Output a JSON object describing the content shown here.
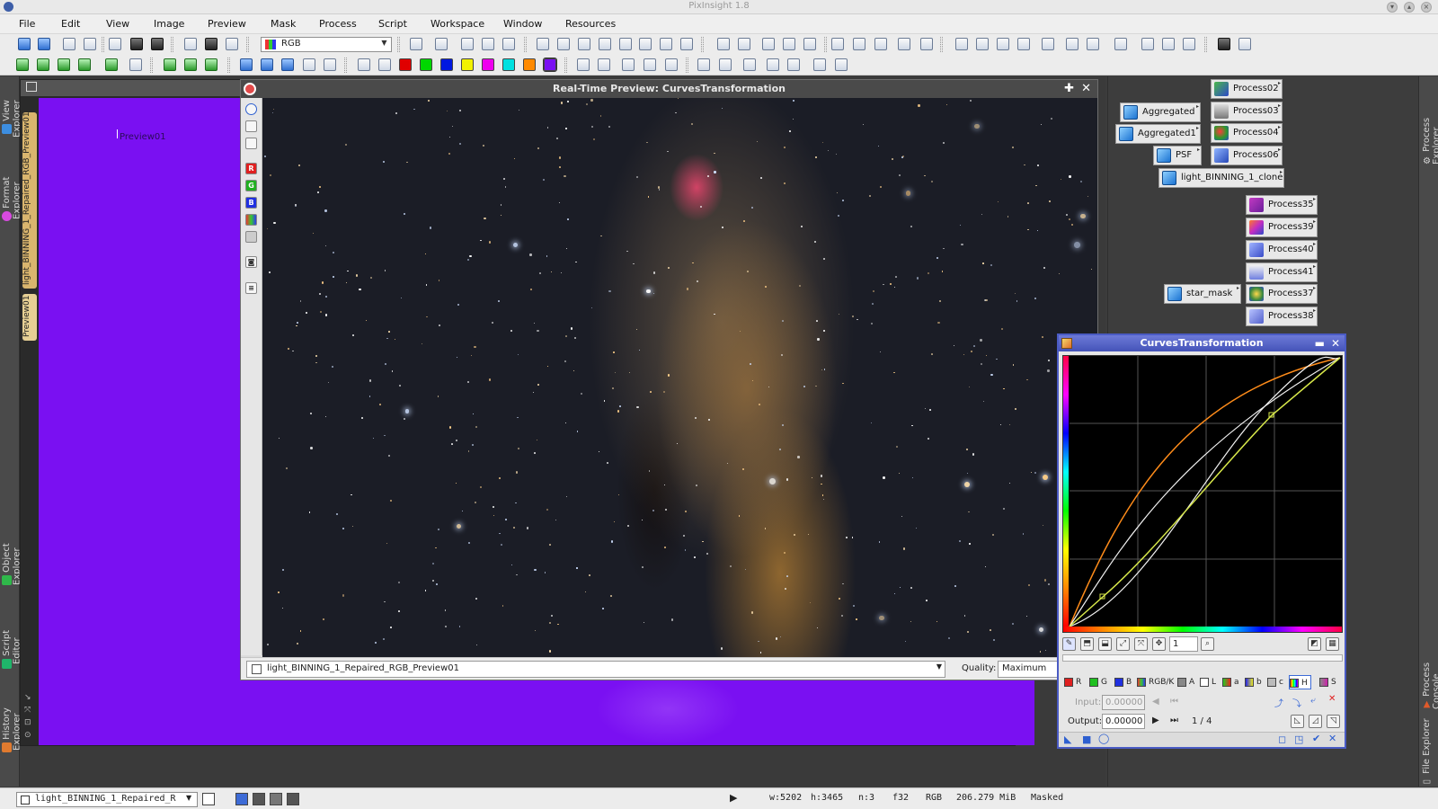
{
  "app": {
    "title": "PixInsight 1.8"
  },
  "menu": [
    "File",
    "Edit",
    "View",
    "Image",
    "Preview",
    "Mask",
    "Process",
    "Script",
    "Workspace",
    "Window",
    "Resources"
  ],
  "toolbar": {
    "color_space_select": "RGB"
  },
  "left_dock": {
    "view_explorer": "View Explorer",
    "format_explorer": "Format Explorer",
    "object_explorer": "Object Explorer",
    "script_editor": "Script Editor",
    "history_explorer": "History Explorer"
  },
  "right_dock": {
    "process_explorer": "Process Explorer",
    "process_console": "Process Console",
    "file_explorer": "File Explorer"
  },
  "image_window": {
    "preview_label": "Preview01",
    "side_tab_main": "light_BINNING_1_Repaired_RGB_Preview01",
    "side_tab_preview": "Preview01"
  },
  "realtime_preview": {
    "title": "Real-Time Preview: CurvesTransformation",
    "view_select": "light_BINNING_1_Repaired_RGB_Preview01",
    "quality_label": "Quality:",
    "quality_value": "Maximum",
    "channel_buttons": [
      "R",
      "G",
      "B"
    ]
  },
  "process_icons": [
    {
      "label": "Process02",
      "kind": "process"
    },
    {
      "label": "Aggregated",
      "kind": "cube"
    },
    {
      "label": "Process03",
      "kind": "process"
    },
    {
      "label": "Aggregated1",
      "kind": "cube"
    },
    {
      "label": "Process04",
      "kind": "process"
    },
    {
      "label": "PSF",
      "kind": "cube"
    },
    {
      "label": "Process06",
      "kind": "process"
    },
    {
      "label": "light_BINNING_1_clone",
      "kind": "cube"
    },
    {
      "label": "Process35",
      "kind": "process"
    },
    {
      "label": "Process39",
      "kind": "process"
    },
    {
      "label": "Process40",
      "kind": "process"
    },
    {
      "label": "Process41",
      "kind": "process"
    },
    {
      "label": "star_mask",
      "kind": "cube"
    },
    {
      "label": "Process37",
      "kind": "process"
    },
    {
      "label": "Process38",
      "kind": "process"
    }
  ],
  "curves": {
    "title": "CurvesTransformation",
    "zoom_value": "1",
    "channels": [
      "R",
      "G",
      "B",
      "RGB/K",
      "A",
      "L",
      "a",
      "b",
      "c",
      "H",
      "S"
    ],
    "active_channel": "H",
    "input_label": "Input:",
    "input_value": "0.00000",
    "output_label": "Output:",
    "output_value": "0.00000",
    "point_index": "1 / 4",
    "colors": {
      "orange_curve": "#ff8c1a",
      "white_curve": "#f2f2f2",
      "yellow_curve": "#d8e84a"
    }
  },
  "statusbar": {
    "view_select": "light_BINNING_1_Repaired_R",
    "width": "w:5202",
    "height": "h:3465",
    "channels": "n:3",
    "sample_format": "f32",
    "color_space": "RGB",
    "size": "206.279 MiB",
    "mask_state": "Masked"
  }
}
